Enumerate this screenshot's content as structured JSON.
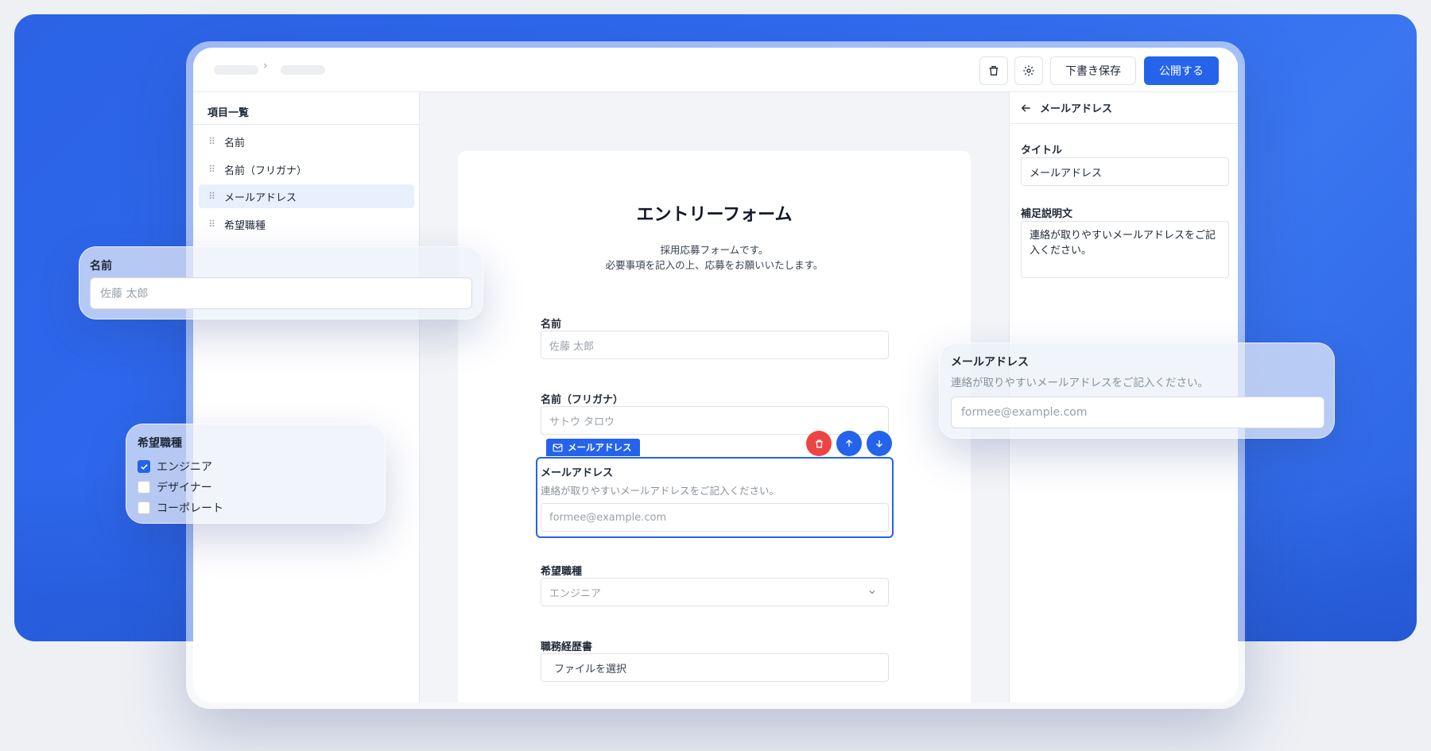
{
  "toolbar": {
    "save_draft_label": "下書き保存",
    "publish_label": "公開する",
    "breadcrumb_separator": "›"
  },
  "sidebar": {
    "title": "項目一覧",
    "items": [
      {
        "label": "名前"
      },
      {
        "label": "名前（フリガナ）"
      },
      {
        "label": "メールアドレス"
      },
      {
        "label": "希望職種"
      }
    ]
  },
  "form": {
    "title": "エントリーフォーム",
    "description_line1": "採用応募フォームです。",
    "description_line2": "必要事項を記入の上、応募をお願いいたします。",
    "fields": {
      "name": {
        "label": "名前",
        "placeholder": "佐藤 太郎"
      },
      "furigana": {
        "label": "名前（フリガナ）",
        "placeholder": "サトウ タロウ"
      },
      "email": {
        "tag": "メールアドレス",
        "label": "メールアドレス",
        "help": "連絡が取りやすいメールアドレスをご記入ください。",
        "placeholder": "formee@example.com"
      },
      "job": {
        "label": "希望職種",
        "value": "エンジニア"
      },
      "resume": {
        "label": "職務経歴書",
        "button": "ファイルを選択"
      }
    }
  },
  "panel": {
    "title": "メールアドレス",
    "title_label": "タイトル",
    "title_value": "メールアドレス",
    "desc_label": "補足説明文",
    "desc_value": "連絡が取りやすいメールアドレスをご記入ください。"
  },
  "float_name": {
    "label": "名前",
    "placeholder": "佐藤 太郎"
  },
  "float_job": {
    "label": "希望職種",
    "options": [
      {
        "label": "エンジニア",
        "checked": true
      },
      {
        "label": "デザイナー",
        "checked": false
      },
      {
        "label": "コーポレート",
        "checked": false
      }
    ]
  },
  "float_email": {
    "label": "メールアドレス",
    "help": "連絡が取りやすいメールアドレスをご記入ください。",
    "placeholder": "formee@example.com"
  },
  "colors": {
    "accent": "#2563eb",
    "danger": "#ef4444",
    "background_blue": "#2f6aef"
  }
}
